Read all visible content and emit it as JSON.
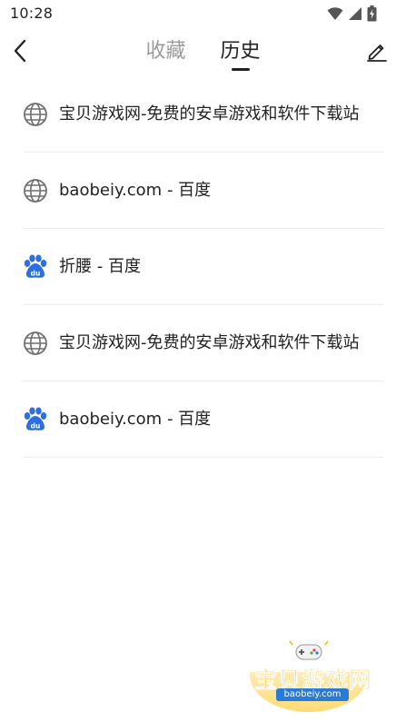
{
  "status_bar": {
    "time": "10:28",
    "icons": [
      "wifi-icon",
      "cellular-signal-icon",
      "battery-charging-icon"
    ]
  },
  "header": {
    "back_icon": "chevron-left-icon",
    "tabs": [
      {
        "label": "收藏",
        "active": false
      },
      {
        "label": "历史",
        "active": true
      }
    ],
    "edit_icon": "pencil-icon"
  },
  "history": {
    "items": [
      {
        "icon": "globe-icon",
        "title": "宝贝游戏网-免费的安卓游戏和软件下载站"
      },
      {
        "icon": "globe-icon",
        "title": "baobeiy.com - 百度"
      },
      {
        "icon": "baidu-paw-icon",
        "title": "折腰 - 百度"
      },
      {
        "icon": "globe-icon",
        "title": "宝贝游戏网-免费的安卓游戏和软件下载站"
      },
      {
        "icon": "baidu-paw-icon",
        "title": "baobeiy.com - 百度"
      }
    ]
  },
  "watermark": {
    "title": "宝贝游戏网",
    "url": "baobeiy.com"
  },
  "colors": {
    "active_tab": "#222222",
    "inactive_tab": "#9a9a9a",
    "divider": "#ececec",
    "baidu_blue": "#2d6fe0",
    "globe_gray": "#6f6f6f",
    "watermark_orange": "#ffb400"
  }
}
